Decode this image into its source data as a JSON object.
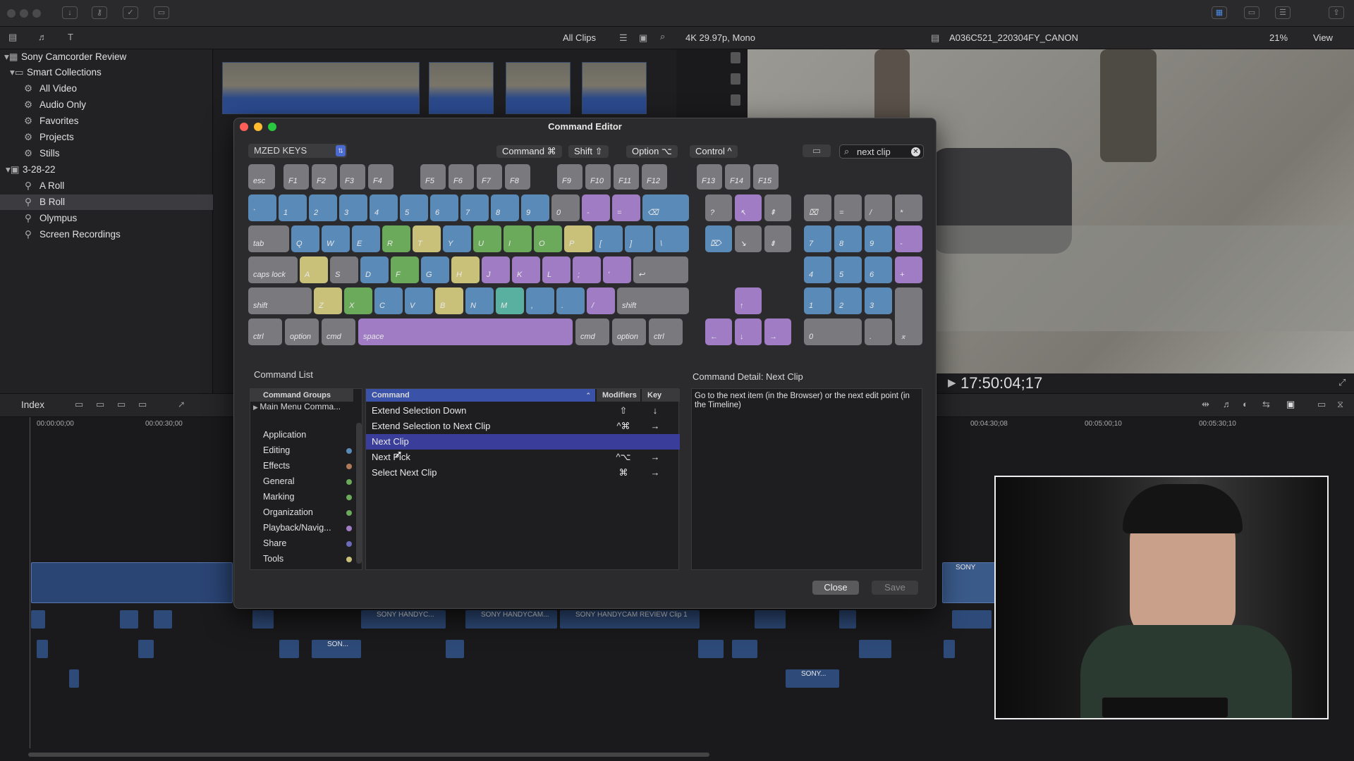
{
  "toolbar": {
    "all_clips": "All Clips",
    "format": "4K 29.97p, Mono",
    "clip_name": "A036C521_220304FY_CANON",
    "zoom": "21%",
    "view": "View"
  },
  "sidebar": {
    "library": "Sony Camcorder Review",
    "smart_collections": "Smart Collections",
    "items": [
      "All Video",
      "Audio Only",
      "Favorites",
      "Projects",
      "Stills"
    ],
    "event": "3-28-22",
    "keywords": [
      "A Roll",
      "B Roll",
      "Olympus",
      "Screen Recordings"
    ]
  },
  "viewer": {
    "timecode": "17:50:04;17"
  },
  "timeline": {
    "index": "Index",
    "ruler": [
      "00:00:00;00",
      "00:00:30;00",
      "00:04:30;08",
      "00:05:00;10",
      "00:05:30;10"
    ],
    "clip_labels": [
      "SONY HANDYC...",
      "SONY HANDYCAM...",
      "SONY HANDYCAM REVIEW Clip 1",
      "SON...",
      "SONY...",
      "SONY"
    ]
  },
  "dialog": {
    "title": "Command Editor",
    "preset": "MZED KEYS",
    "modifiers": [
      "Command ⌘",
      "Shift ⇧",
      "Option ⌥",
      "Control ^"
    ],
    "search_value": "next clip",
    "command_list_title": "Command List",
    "groups_header": "Command Groups",
    "groups_first": "Main Menu Comma...",
    "groups": [
      {
        "name": "Application",
        "color": ""
      },
      {
        "name": "Editing",
        "color": "#5a8ab8"
      },
      {
        "name": "Effects",
        "color": "#b07a5a"
      },
      {
        "name": "General",
        "color": "#6aaa5a"
      },
      {
        "name": "Marking",
        "color": "#6aaa5a"
      },
      {
        "name": "Organization",
        "color": "#6aaa5a"
      },
      {
        "name": "Playback/Navig...",
        "color": "#a07cc4"
      },
      {
        "name": "Share",
        "color": "#6a6ab8"
      },
      {
        "name": "Tools",
        "color": "#c9c07a"
      }
    ],
    "cols": {
      "command": "Command",
      "modifiers": "Modifiers",
      "key": "Key"
    },
    "commands": [
      {
        "name": "Extend Selection Down",
        "mod": "⇧",
        "key": "↓"
      },
      {
        "name": "Extend Selection to Next Clip",
        "mod": "^⌘",
        "key": "→"
      },
      {
        "name": "Next Clip",
        "mod": "",
        "key": ""
      },
      {
        "name": "Next Pick",
        "mod": "^⌥",
        "key": "→"
      },
      {
        "name": "Select Next Clip",
        "mod": "⌘",
        "key": "→"
      }
    ],
    "detail_title": "Command Detail: Next Clip",
    "detail_text": "Go to the next item (in the Browser) or the next edit point (in the Timeline)",
    "close": "Close",
    "save": "Save",
    "keys": {
      "esc": "esc",
      "f": [
        "F1",
        "F2",
        "F3",
        "F4",
        "F5",
        "F6",
        "F7",
        "F8",
        "F9",
        "F10",
        "F11",
        "F12",
        "F13",
        "F14",
        "F15"
      ],
      "num": [
        "`",
        "1",
        "2",
        "3",
        "4",
        "5",
        "6",
        "7",
        "8",
        "9",
        "0",
        "-",
        "=",
        "⌫"
      ],
      "row_q": [
        "tab",
        "Q",
        "W",
        "E",
        "R",
        "T",
        "Y",
        "U",
        "I",
        "O",
        "P",
        "[",
        "]",
        "\\"
      ],
      "row_a": [
        "caps lock",
        "A",
        "S",
        "D",
        "F",
        "G",
        "H",
        "J",
        "K",
        "L",
        ";",
        "'",
        "↩"
      ],
      "row_z": [
        "shift",
        "Z",
        "X",
        "C",
        "V",
        "B",
        "N",
        "M",
        ",",
        ".",
        "/",
        "shift"
      ],
      "row_b": [
        "ctrl",
        "option",
        "cmd",
        "space",
        "cmd",
        "option",
        "ctrl"
      ],
      "nav": [
        "?",
        "↖",
        "⇞",
        "⌦",
        "↘",
        "⇟"
      ],
      "arrows": [
        "↑",
        "←",
        "↓",
        "→"
      ],
      "pad": [
        "⌧",
        "=",
        "/",
        "*",
        "7",
        "8",
        "9",
        "-",
        "4",
        "5",
        "6",
        "+",
        "1",
        "2",
        "3",
        "0",
        ".",
        "⌅"
      ]
    }
  }
}
